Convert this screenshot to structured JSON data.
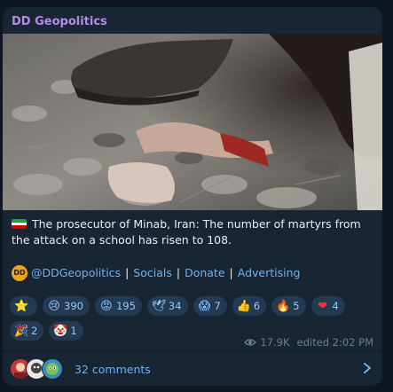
{
  "channel": {
    "name": "DD Geopolitics"
  },
  "photo": {
    "alt_icon": "photo"
  },
  "message": {
    "flag_icon": "iran-flag-icon",
    "text": "The prosecutor of Minab, Iran: The number of martyrs from the attack on a school has risen to 108."
  },
  "links": {
    "logo_text": "DD",
    "handle": "@DDGeopolitics",
    "socials": "Socials",
    "donate": "Donate",
    "advertising": "Advertising",
    "separator": "|"
  },
  "reactions": [
    {
      "emoji": "⭐",
      "icon": "star-icon",
      "count": ""
    },
    {
      "emoji": "😢",
      "icon": "crying-face-icon",
      "count": "390"
    },
    {
      "emoji": "😡",
      "icon": "angry-face-icon",
      "count": "195"
    },
    {
      "emoji": "🕊",
      "icon": "dove-icon",
      "count": "34"
    },
    {
      "emoji": "😱",
      "icon": "screaming-face-icon",
      "count": "7"
    },
    {
      "emoji": "👍",
      "icon": "thumbs-up-icon",
      "count": "6"
    },
    {
      "emoji": "🔥",
      "icon": "fire-icon",
      "count": "5"
    },
    {
      "emoji": "❤",
      "icon": "heart-icon",
      "count": "4"
    },
    {
      "emoji": "🎉",
      "icon": "party-popper-icon",
      "count": "2"
    },
    {
      "emoji": "🤡",
      "icon": "clown-face-icon",
      "count": "1"
    }
  ],
  "meta": {
    "views": "17.9K",
    "edited": "edited 2:02 PM"
  },
  "comments": {
    "label": "32 comments"
  },
  "colors": {
    "accent": "#6ab3f3",
    "channel": "#b38cea",
    "background": "#0e1621",
    "bubble": "#182533"
  }
}
